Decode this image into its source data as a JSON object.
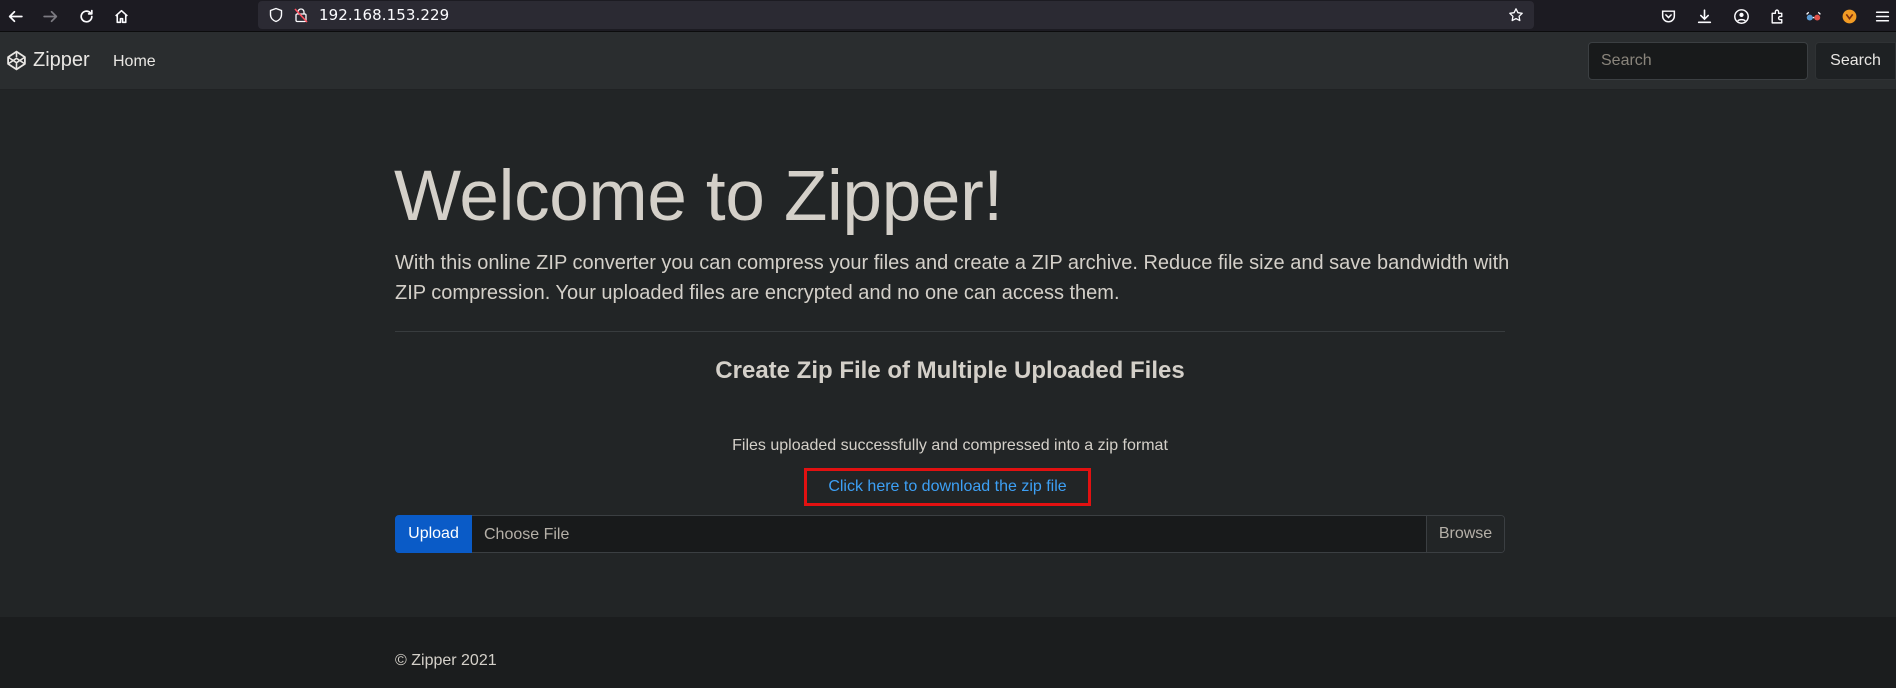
{
  "browser": {
    "url": "192.168.153.229",
    "icons": [
      "back-icon",
      "forward-icon",
      "reload-icon",
      "home-icon",
      "shield-icon",
      "lock-insecure-icon",
      "bookmark-star-icon",
      "pocket-icon",
      "downloads-icon",
      "account-icon",
      "extensions-icon",
      "extension-glasses-icon",
      "extension-fox-icon",
      "menu-icon"
    ]
  },
  "navbar": {
    "brand": "Zipper",
    "home_label": "Home",
    "search_placeholder": "Search",
    "search_button": "Search"
  },
  "main": {
    "title": "Welcome to Zipper!",
    "lead": "With this online ZIP converter you can compress your files and create a ZIP archive. Reduce file size and save bandwidth with ZIP compression. Your uploaded files are encrypted and no one can access them.",
    "subtitle": "Create Zip File of Multiple Uploaded Files",
    "status": "Files uploaded successfully and compressed into a zip format",
    "download_link": "Click here to download the zip file",
    "upload_button": "Upload",
    "file_placeholder": "Choose File",
    "browse_label": "Browse"
  },
  "footer": {
    "copyright": "© Zipper 2021"
  },
  "colors": {
    "accent": "#0a5bc7",
    "link": "#3da0f5",
    "highlight_box": "#e21111"
  }
}
